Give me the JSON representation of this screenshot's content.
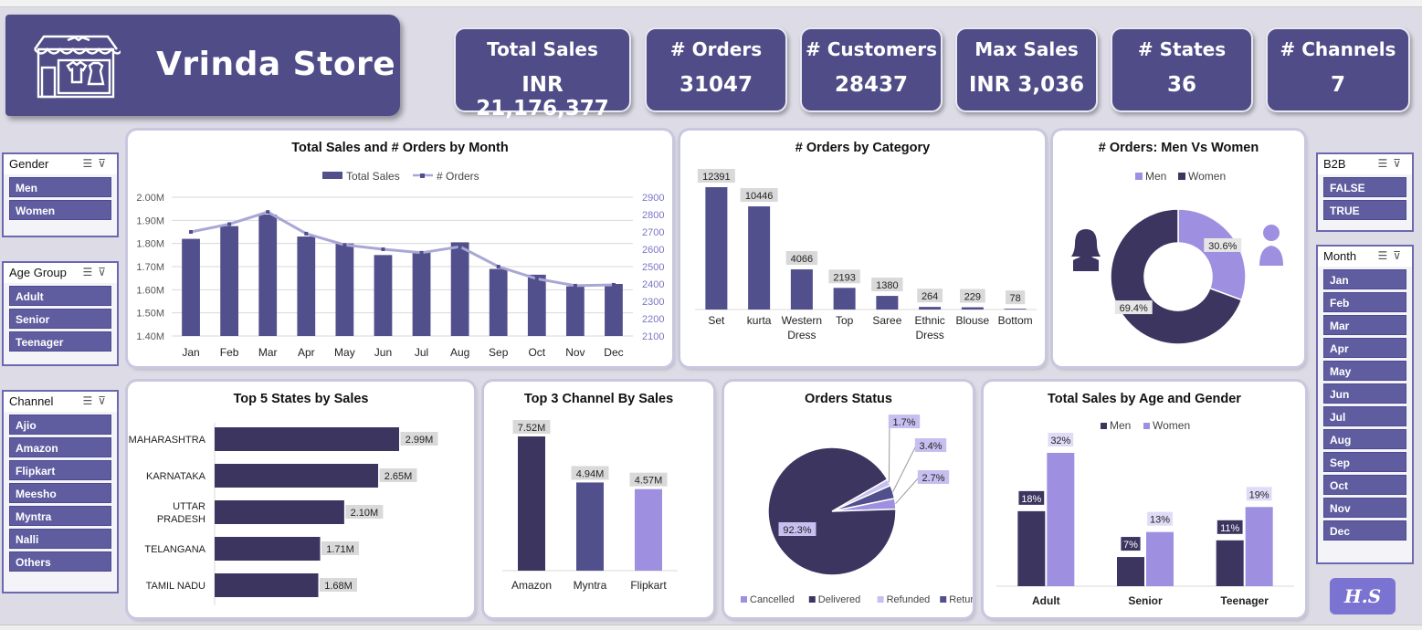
{
  "title": "Vrinda Store",
  "badge": "H.S",
  "kpis": [
    {
      "label": "Total Sales",
      "value": "INR 21,176,377"
    },
    {
      "label": "# Orders",
      "value": "31047"
    },
    {
      "label": "# Customers",
      "value": "28437"
    },
    {
      "label": "Max Sales",
      "value": "INR 3,036"
    },
    {
      "label": "# States",
      "value": "36"
    },
    {
      "label": "# Channels",
      "value": "7"
    }
  ],
  "slicers": {
    "gender": {
      "title": "Gender",
      "items": [
        "Men",
        "Women"
      ]
    },
    "age_group": {
      "title": "Age Group",
      "items": [
        "Adult",
        "Senior",
        "Teenager"
      ]
    },
    "channel": {
      "title": "Channel",
      "items": [
        "Ajio",
        "Amazon",
        "Flipkart",
        "Meesho",
        "Myntra",
        "Nalli",
        "Others"
      ]
    },
    "b2b": {
      "title": "B2B",
      "items": [
        "FALSE",
        "TRUE"
      ]
    },
    "month": {
      "title": "Month",
      "items": [
        "Jan",
        "Feb",
        "Mar",
        "Apr",
        "May",
        "Jun",
        "Jul",
        "Aug",
        "Sep",
        "Oct",
        "Nov",
        "Dec"
      ]
    }
  },
  "colors": {
    "dark_purple": "#3b3560",
    "mid_purple": "#514f8c",
    "light_purple": "#9f8fe0",
    "line_lavender": "#a9a7d6"
  },
  "chart_data": [
    {
      "id": "sales_orders_month",
      "type": "bar+line",
      "title": "Total Sales and # Orders by Month",
      "categories": [
        "Jan",
        "Feb",
        "Mar",
        "Apr",
        "May",
        "Jun",
        "Jul",
        "Aug",
        "Sep",
        "Oct",
        "Nov",
        "Dec"
      ],
      "series": [
        {
          "name": "Total Sales",
          "type": "bar",
          "axis": "left",
          "values": [
            1.82,
            1.875,
            1.925,
            1.83,
            1.8,
            1.75,
            1.765,
            1.805,
            1.69,
            1.665,
            1.615,
            1.625
          ]
        },
        {
          "name": "# Orders",
          "type": "line",
          "axis": "right",
          "values": [
            2700,
            2745,
            2815,
            2690,
            2625,
            2600,
            2580,
            2615,
            2500,
            2430,
            2390,
            2395
          ]
        }
      ],
      "y_left": {
        "ticks": [
          "1.40M",
          "1.50M",
          "1.60M",
          "1.70M",
          "1.80M",
          "1.90M",
          "2.00M"
        ],
        "range": [
          1.4,
          2.0
        ]
      },
      "y_right": {
        "ticks": [
          "2100",
          "2200",
          "2300",
          "2400",
          "2500",
          "2600",
          "2700",
          "2800",
          "2900"
        ],
        "range": [
          2100,
          2900
        ]
      },
      "legend_position": "top"
    },
    {
      "id": "orders_by_category",
      "type": "bar",
      "title": "# Orders by Category",
      "categories": [
        "Set",
        "kurta",
        "Western Dress",
        "Top",
        "Saree",
        "Ethnic Dress",
        "Blouse",
        "Bottom"
      ],
      "category_lines": [
        [
          "Set"
        ],
        [
          "kurta"
        ],
        [
          "Western",
          "Dress"
        ],
        [
          "Top"
        ],
        [
          "Saree"
        ],
        [
          "Ethnic",
          "Dress"
        ],
        [
          "Blouse"
        ],
        [
          "Bottom"
        ]
      ],
      "values": [
        12391,
        10446,
        4066,
        2193,
        1380,
        264,
        229,
        78
      ]
    },
    {
      "id": "orders_men_women",
      "type": "donut",
      "title": "# Orders: Men Vs Women",
      "labels": [
        "Men",
        "Women"
      ],
      "values": [
        30.6,
        69.4
      ],
      "data_labels": [
        "30.6%",
        "69.4%"
      ],
      "legend_position": "top"
    },
    {
      "id": "top5_states",
      "type": "bar",
      "orientation": "horizontal",
      "title": "Top 5 States by Sales",
      "categories": [
        "MAHARASHTRA",
        "KARNATAKA",
        "UTTAR PRADESH",
        "TELANGANA",
        "TAMIL NADU"
      ],
      "category_lines": [
        [
          "MAHARASHTRA"
        ],
        [
          "KARNATAKA"
        ],
        [
          "UTTAR",
          "PRADESH"
        ],
        [
          "TELANGANA"
        ],
        [
          "TAMIL NADU"
        ]
      ],
      "values": [
        2.99,
        2.65,
        2.1,
        1.71,
        1.68
      ],
      "data_labels": [
        "2.99M",
        "2.65M",
        "2.10M",
        "1.71M",
        "1.68M"
      ]
    },
    {
      "id": "top3_channel",
      "type": "bar",
      "title": "Top 3 Channel By Sales",
      "categories": [
        "Amazon",
        "Myntra",
        "Flipkart"
      ],
      "values": [
        7.52,
        4.94,
        4.57
      ],
      "data_labels": [
        "7.52M",
        "4.94M",
        "4.57M"
      ]
    },
    {
      "id": "orders_status",
      "type": "pie",
      "title": "Orders Status",
      "labels": [
        "Cancelled",
        "Delivered",
        "Refunded",
        "Returned"
      ],
      "values": [
        2.7,
        92.3,
        1.7,
        3.4
      ],
      "data_labels": [
        "2.7%",
        "92.3%",
        "1.7%",
        "3.4%"
      ],
      "legend_position": "bottom"
    },
    {
      "id": "sales_age_gender",
      "type": "bar",
      "title": "Total Sales by Age and Gender",
      "categories": [
        "Adult",
        "Senior",
        "Teenager"
      ],
      "series": [
        {
          "name": "Men",
          "values": [
            18,
            7,
            11
          ],
          "data_labels": [
            "18%",
            "7%",
            "11%"
          ]
        },
        {
          "name": "Women",
          "values": [
            32,
            13,
            19
          ],
          "data_labels": [
            "32%",
            "13%",
            "19%"
          ]
        }
      ],
      "legend_position": "top"
    }
  ]
}
